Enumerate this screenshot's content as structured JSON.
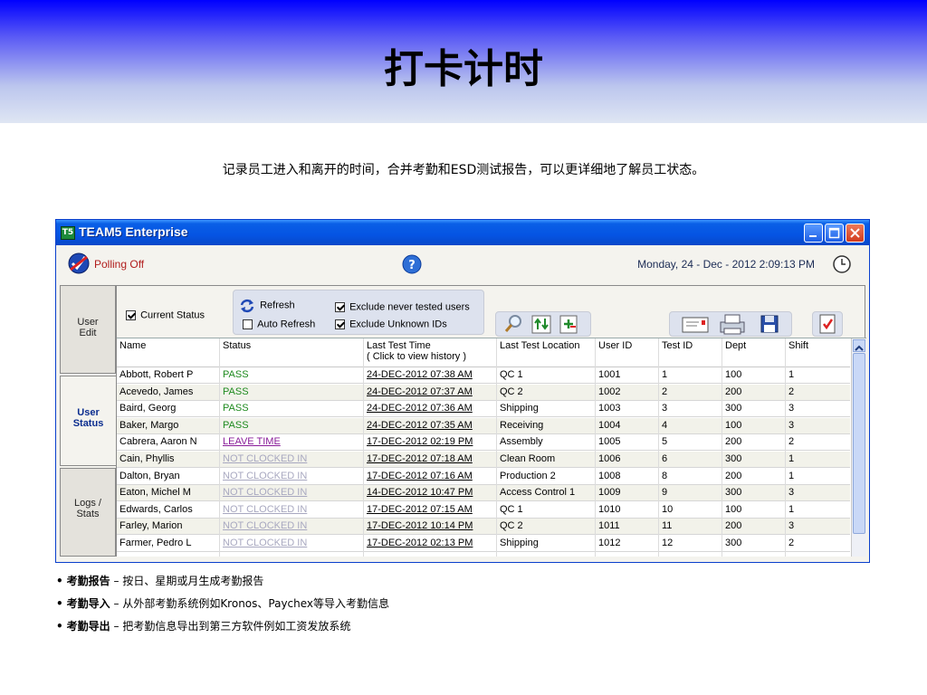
{
  "slide": {
    "title": "打卡计时",
    "subtitle": "记录员工进入和离开的时间，合并考勤和ESD测试报告，可以更详细地了解员工状态。",
    "bullets": [
      {
        "head": "考勤报告",
        "text": " – 按日、星期或月生成考勤报告"
      },
      {
        "head": "考勤导入",
        "text": " – 从外部考勤系统例如Kronos、Paychex等导入考勤信息"
      },
      {
        "head": "考勤导出",
        "text": " – 把考勤信息导出到第三方软件例如工资发放系统"
      }
    ]
  },
  "app": {
    "title": "TEAM5 Enterprise",
    "icon_text": "T5",
    "polling": "Polling Off",
    "datetime": "Monday, 24 - Dec - 2012   2:09:13 PM",
    "nav": [
      {
        "line1": "User",
        "line2": "Edit"
      },
      {
        "line1": "User",
        "line2": "Status"
      },
      {
        "line1": "Logs /",
        "line2": "Stats"
      }
    ],
    "toolbar": {
      "current_status": "Current Status",
      "refresh": "Refresh",
      "auto_refresh": "Auto Refresh",
      "exclude_never": "Exclude never tested users",
      "exclude_unknown": "Exclude Unknown IDs"
    },
    "columns": [
      "Name",
      "Status",
      "Last Test Time",
      "( Click to view history )",
      "Last Test Location",
      "User ID",
      "Test ID",
      "Dept",
      "Shift"
    ],
    "rows": [
      {
        "name": "Abbott, Robert P",
        "status": "PASS",
        "time": "24-DEC-2012 07:38 AM",
        "loc": "QC 1",
        "uid": "1001",
        "tid": "1",
        "dept": "100",
        "shift": "1"
      },
      {
        "name": "Acevedo, James",
        "status": "PASS",
        "time": "24-DEC-2012 07:37 AM",
        "loc": "QC 2",
        "uid": "1002",
        "tid": "2",
        "dept": "200",
        "shift": "2"
      },
      {
        "name": "Baird, Georg",
        "status": "PASS",
        "time": "24-DEC-2012 07:36 AM",
        "loc": "Shipping",
        "uid": "1003",
        "tid": "3",
        "dept": "300",
        "shift": "3"
      },
      {
        "name": "Baker, Margo",
        "status": "PASS",
        "time": "24-DEC-2012 07:35 AM",
        "loc": "Receiving",
        "uid": "1004",
        "tid": "4",
        "dept": "100",
        "shift": "3"
      },
      {
        "name": "Cabrera, Aaron N",
        "status": "LEAVE TIME",
        "time": "17-DEC-2012 02:19 PM",
        "loc": "Assembly",
        "uid": "1005",
        "tid": "5",
        "dept": "200",
        "shift": "2"
      },
      {
        "name": "Cain, Phyllis",
        "status": "NOT CLOCKED IN",
        "time": "17-DEC-2012 07:18 AM",
        "loc": "Clean Room",
        "uid": "1006",
        "tid": "6",
        "dept": "300",
        "shift": "1"
      },
      {
        "name": "Dalton, Bryan",
        "status": "NOT CLOCKED IN",
        "time": "17-DEC-2012 07:16 AM",
        "loc": "Production 2",
        "uid": "1008",
        "tid": "8",
        "dept": "200",
        "shift": "1"
      },
      {
        "name": "Eaton, Michel M",
        "status": "NOT CLOCKED IN",
        "time": "14-DEC-2012 10:47 PM",
        "loc": "Access Control 1",
        "uid": "1009",
        "tid": "9",
        "dept": "300",
        "shift": "3"
      },
      {
        "name": "Edwards, Carlos",
        "status": "NOT CLOCKED IN",
        "time": "17-DEC-2012 07:15 AM",
        "loc": "QC 1",
        "uid": "1010",
        "tid": "10",
        "dept": "100",
        "shift": "1"
      },
      {
        "name": "Farley, Marion",
        "status": "NOT CLOCKED IN",
        "time": "17-DEC-2012 10:14 PM",
        "loc": "QC 2",
        "uid": "1011",
        "tid": "11",
        "dept": "200",
        "shift": "3"
      },
      {
        "name": "Farmer, Pedro L",
        "status": "NOT CLOCKED IN",
        "time": "17-DEC-2012 02:13 PM",
        "loc": "Shipping",
        "uid": "1012",
        "tid": "12",
        "dept": "300",
        "shift": "2"
      }
    ],
    "colors": {
      "pass": "#1e8a1e",
      "leave": "#8a1e9a",
      "not_clocked": "#a8a8c0",
      "titlebar": "#0554e3"
    }
  }
}
